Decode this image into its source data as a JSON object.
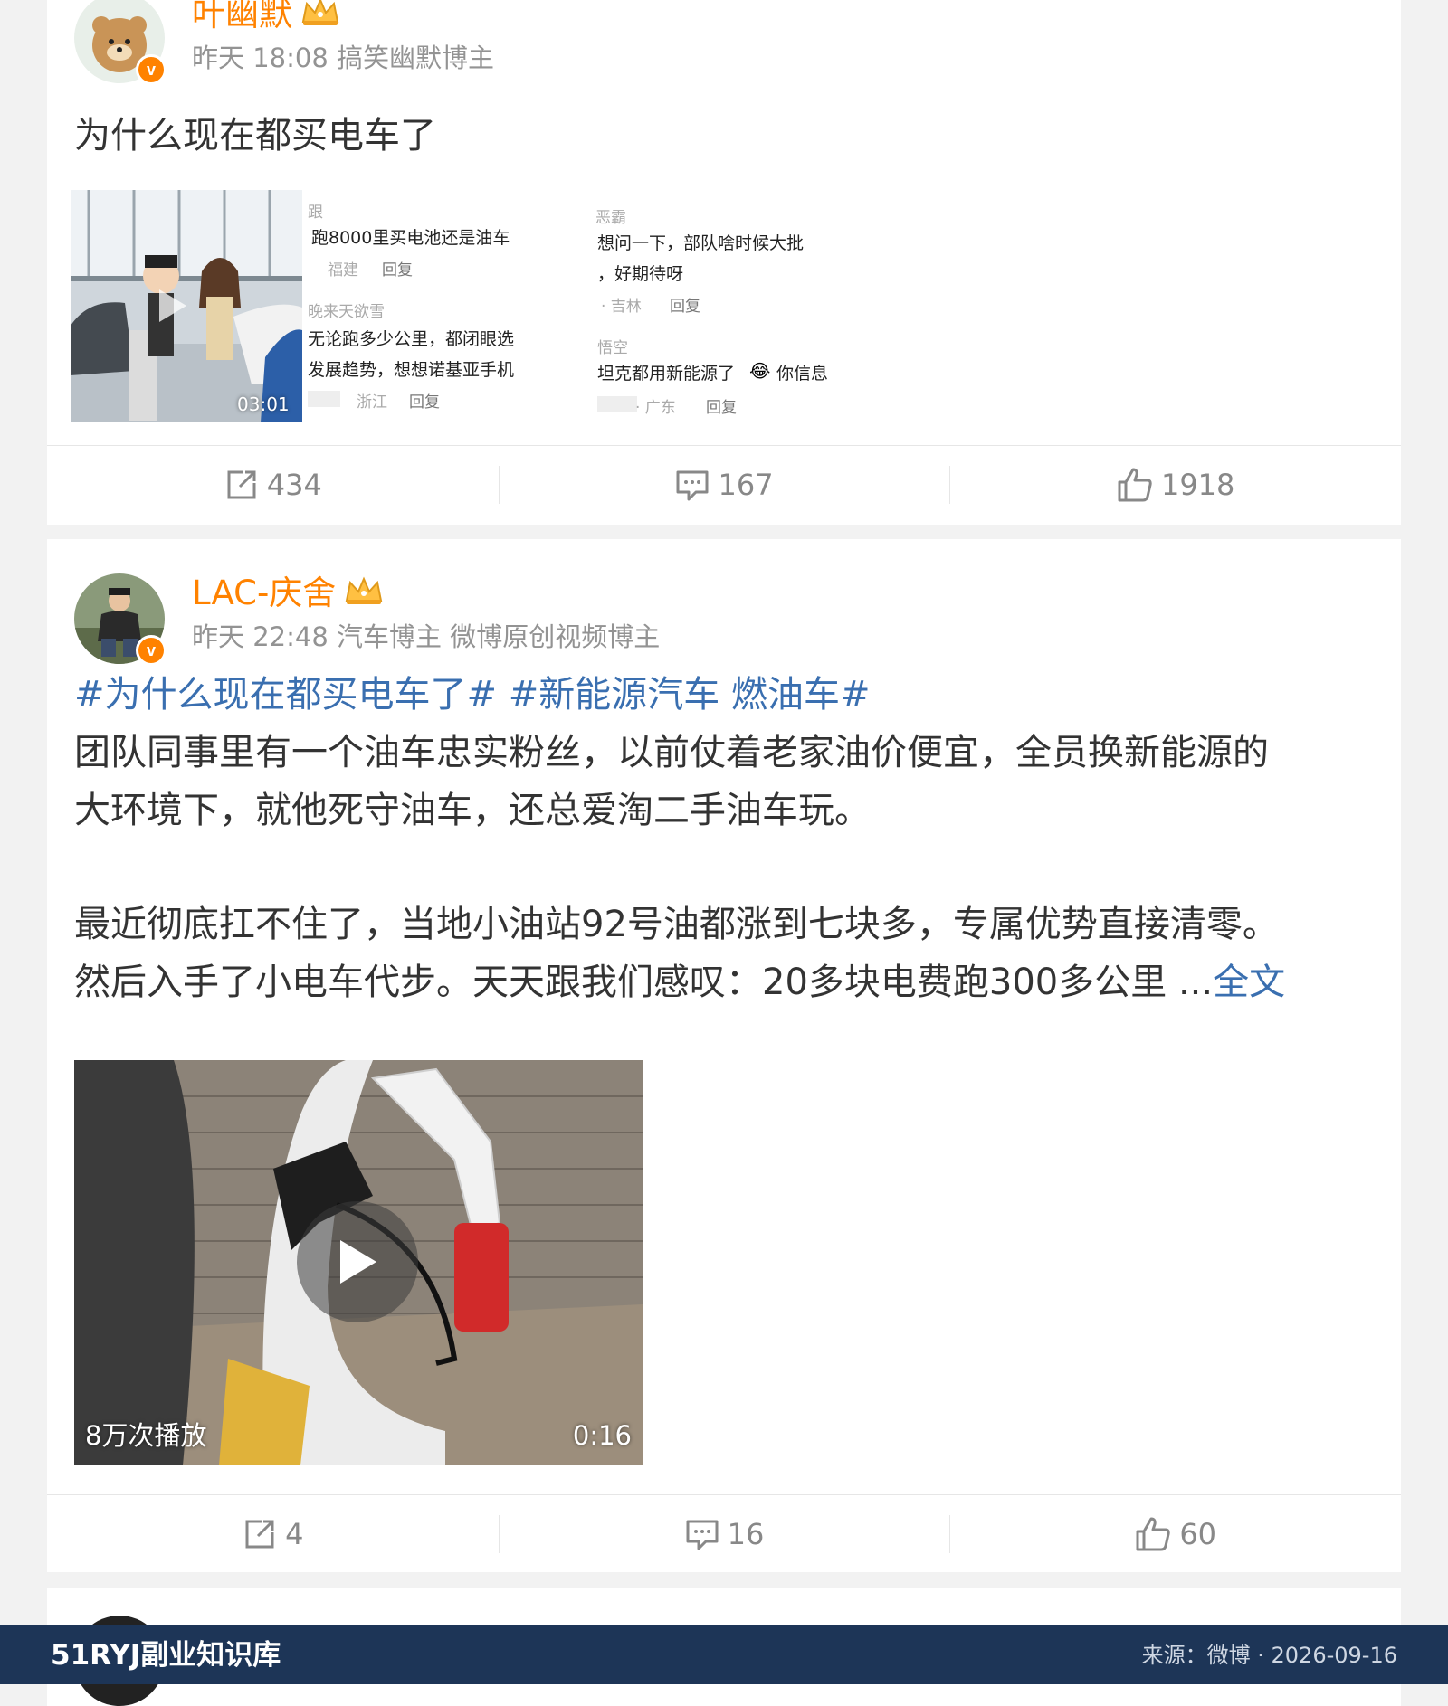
{
  "posts": [
    {
      "username": "叶幽默",
      "meta": "昨天 18:08 搞笑幽默博主",
      "text": "为什么现在都买电车了",
      "video_duration": "03:01",
      "comment_shot": {
        "left": {
          "line1_user": "跟",
          "line1": "跑8000里买电池还是油车",
          "line1_meta_loc": "福建",
          "line1_meta_reply": "回复",
          "line2_user": "晚来天欲雪",
          "line2a": "无论跑多少公里，都闭眼选",
          "line2b": "发展趋势，想想诺基亚手机",
          "line2_meta_loc": "浙江",
          "line2_meta_reply": "回复"
        },
        "right": {
          "line1_user": "恶霸",
          "line1a": "想问一下，部队啥时候大批",
          "line1b": "，好期待呀",
          "line1_meta_loc": "· 吉林",
          "line1_meta_reply": "回复",
          "line2_user": "悟空",
          "line2a": "坦克都用新能源了",
          "line2b": "你信息",
          "line2_meta_loc": "· 广东",
          "line2_meta_reply": "回复"
        }
      },
      "actions": {
        "repost": "434",
        "comment": "167",
        "like": "1918"
      }
    },
    {
      "username": "LAC-庆舍",
      "meta": "昨天 22:48 汽车博主 微博原创视频博主",
      "topic1": "#为什么现在都买电车了#",
      "topic2": "#新能源汽车 燃油车#",
      "line1": "团队同事里有一个油车忠实粉丝，以前仗着老家油价便宜，全员换新能源的",
      "line2": "大环境下，就他死守油车，还总爱淘二手油车玩。",
      "line3": "最近彻底扛不住了，当地小油站92号油都涨到七块多，专属优势直接清零。",
      "line4": "然后入手了小电车代步。天天跟我们感叹：20多块电费跑300多公里",
      "more_dots": " ...",
      "fulltext": "全文",
      "video_plays": "8万次播放",
      "video_duration": "0:16",
      "actions": {
        "repost": "4",
        "comment": "16",
        "like": "60"
      }
    }
  ],
  "footer": {
    "site": "51RYJ副业知识库",
    "source": "来源：微博 · 2026-09-16"
  },
  "colors": {
    "username": "#ff8200",
    "topic": "#3a6fb0",
    "footer_bg": "#1d3557"
  }
}
